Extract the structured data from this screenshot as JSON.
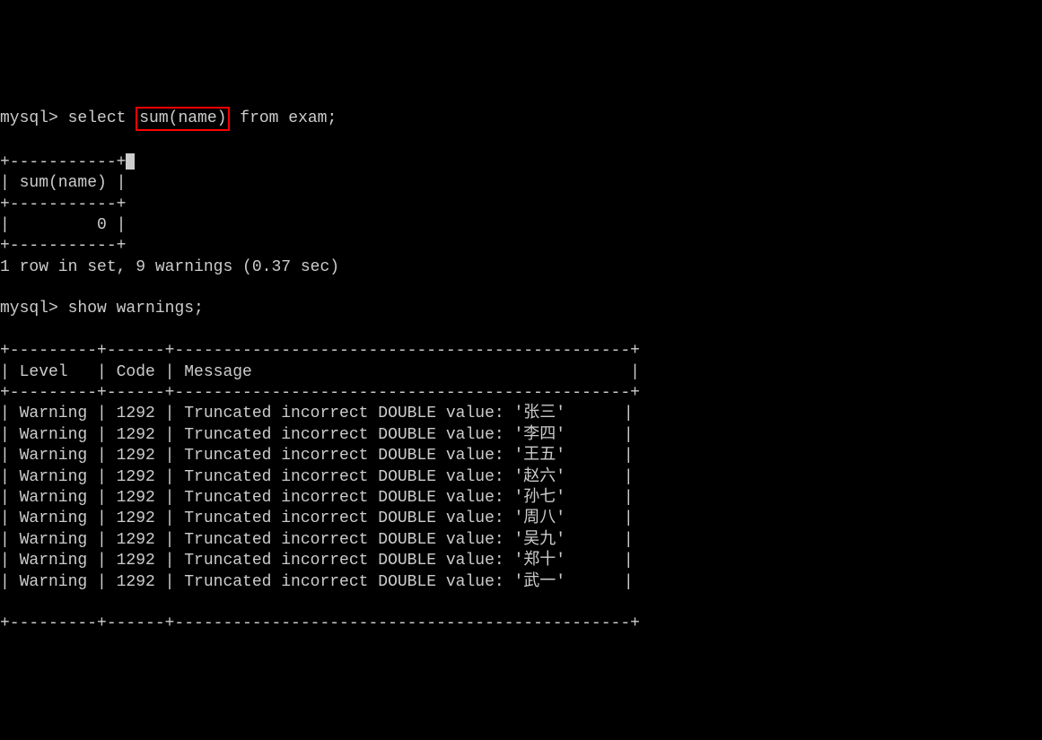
{
  "prompt1": {
    "prefix": "mysql> ",
    "cmd_before": "select ",
    "cmd_highlight": "sum(name)",
    "cmd_after": " from exam;"
  },
  "result_table": {
    "border_top": "+-----------+",
    "header_row": "| sum(name) |",
    "border_mid": "+-----------+",
    "data_row": "|         0 |",
    "border_bot": "+-----------+"
  },
  "result_summary": "1 row in set, 9 warnings (0.37 sec)",
  "blank": "",
  "prompt2": {
    "prefix": "mysql> ",
    "cmd": "show warnings;"
  },
  "warnings_table": {
    "border": "+---------+------+-----------------------------------------------+",
    "header": "| Level   | Code | Message                                       |",
    "rows": [
      "| Warning | 1292 | Truncated incorrect DOUBLE value: '张三'      |",
      "| Warning | 1292 | Truncated incorrect DOUBLE value: '李四'      |",
      "| Warning | 1292 | Truncated incorrect DOUBLE value: '王五'      |",
      "| Warning | 1292 | Truncated incorrect DOUBLE value: '赵六'      |",
      "| Warning | 1292 | Truncated incorrect DOUBLE value: '孙七'      |",
      "| Warning | 1292 | Truncated incorrect DOUBLE value: '周八'      |",
      "| Warning | 1292 | Truncated incorrect DOUBLE value: '吴九'      |",
      "| Warning | 1292 | Truncated incorrect DOUBLE value: '郑十'      |",
      "| Warning | 1292 | Truncated incorrect DOUBLE value: '武一'      |"
    ]
  }
}
